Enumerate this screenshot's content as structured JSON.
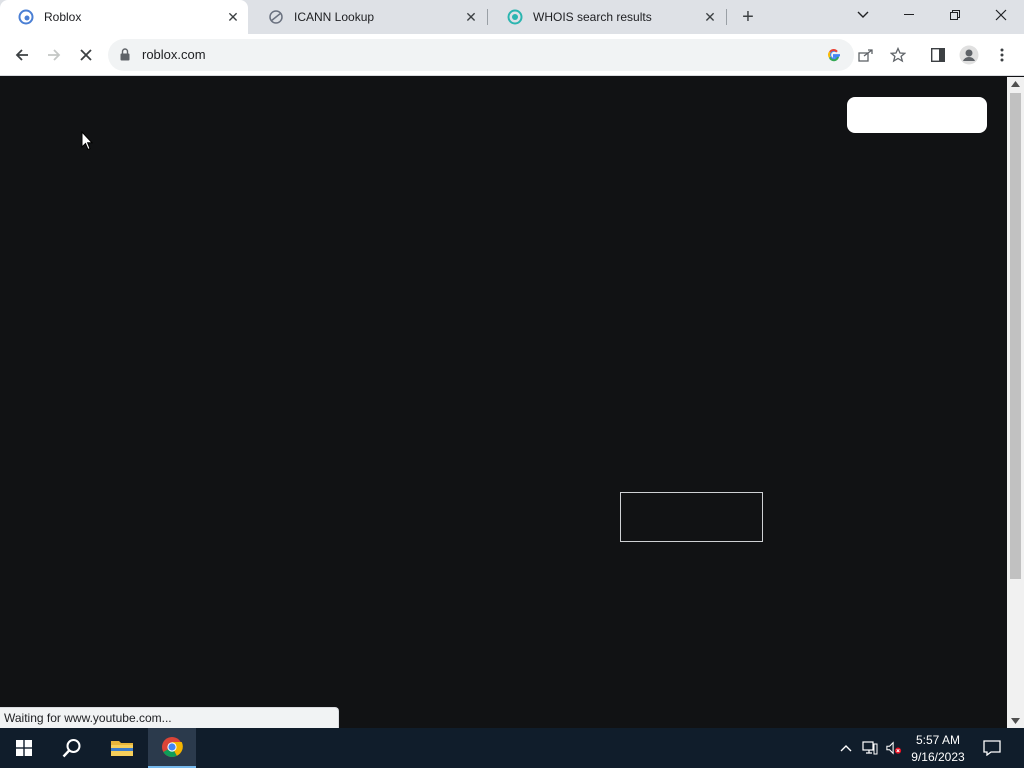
{
  "browser": {
    "tabs": [
      {
        "title": "Roblox",
        "active": true
      },
      {
        "title": "ICANN Lookup",
        "active": false
      },
      {
        "title": "WHOIS search results",
        "active": false
      }
    ],
    "address_bar": {
      "url": "roblox.com"
    },
    "status_text": "Waiting for www.youtube.com..."
  },
  "taskbar": {
    "time": "5:57 AM",
    "date": "9/16/2023"
  },
  "colors": {
    "page_background": "#111214",
    "tab_strip": "#dee1e6",
    "taskbar": "#101d2b"
  },
  "icons": [
    "roblox-favicon",
    "icann-favicon",
    "whois-favicon",
    "back-arrow-icon",
    "forward-arrow-icon",
    "reload-stop-icon",
    "lock-icon",
    "google-icon",
    "share-icon",
    "star-icon",
    "side-panel-icon",
    "profile-icon",
    "kebab-menu-icon",
    "windows-start-icon",
    "search-icon",
    "file-explorer-icon",
    "chrome-icon"
  ]
}
